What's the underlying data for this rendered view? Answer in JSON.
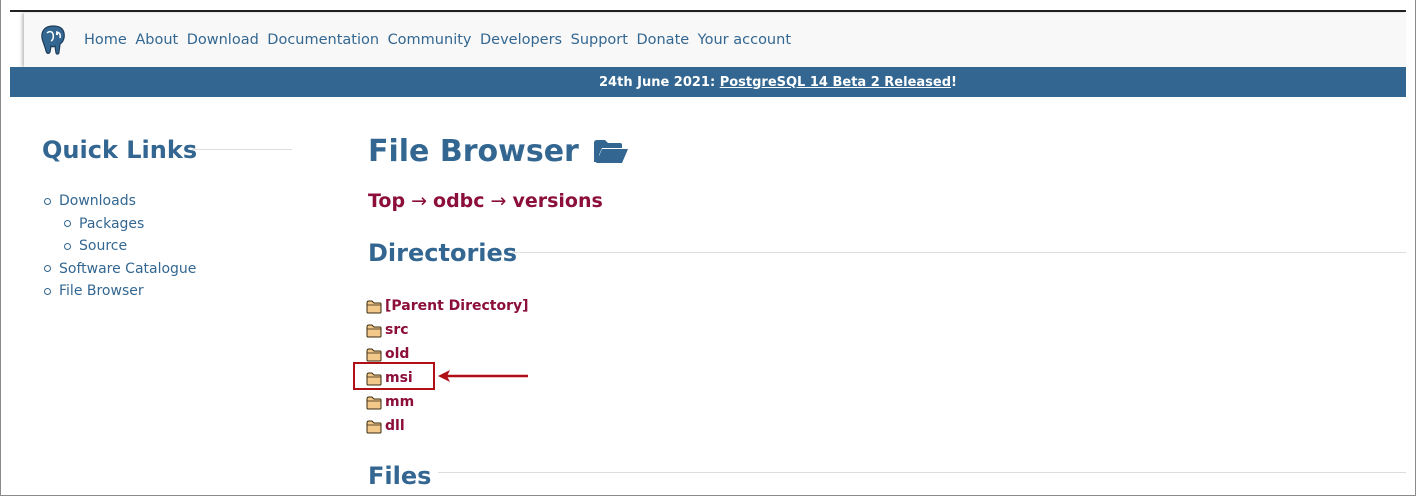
{
  "nav": {
    "items": [
      "Home",
      "About",
      "Download",
      "Documentation",
      "Community",
      "Developers",
      "Support",
      "Donate",
      "Your account"
    ]
  },
  "banner": {
    "date_text": "24th June 2021: ",
    "link_text": "PostgreSQL 14 Beta 2 Released",
    "suffix": "!"
  },
  "quick_links": {
    "title": "Quick Links",
    "items": [
      "Downloads",
      "Packages",
      "Source",
      "Software Catalogue",
      "File Browser"
    ]
  },
  "file_browser": {
    "title": "File Browser",
    "breadcrumb": [
      "Top",
      "odbc",
      "versions"
    ],
    "breadcrumb_separator": "→"
  },
  "directories": {
    "title": "Directories",
    "items": [
      "[Parent Directory]",
      "src",
      "old",
      "msi",
      "mm",
      "dll"
    ]
  },
  "files": {
    "title": "Files"
  },
  "colors": {
    "brand_blue": "#336791",
    "link_maroon": "#8c0e3b",
    "annotation_red": "#b00f16"
  },
  "icons": {
    "logo": "postgresql-elephant-icon",
    "title": "open-folder-icon",
    "directory": "folder-icon"
  }
}
